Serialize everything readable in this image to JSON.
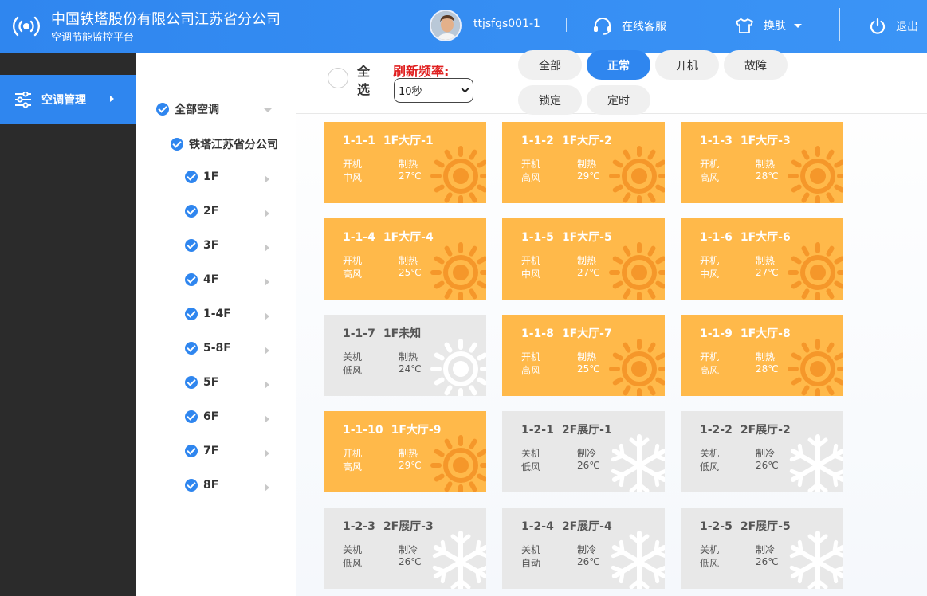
{
  "header": {
    "title_main": "中国铁塔股份有限公司江苏省分公司",
    "title_sub": "空调节能监控平台",
    "username": "ttjsfgs001-1",
    "service": "在线客服",
    "skin": "换肤",
    "logout": "退出"
  },
  "sidebar": {
    "items": [
      {
        "label": "空调管理"
      }
    ]
  },
  "tree": {
    "root": "全部空调",
    "company": "铁塔江苏省分公司",
    "floors": [
      "1F",
      "2F",
      "3F",
      "4F",
      "1-4F",
      "5-8F",
      "5F",
      "6F",
      "7F",
      "8F"
    ]
  },
  "toolbar": {
    "select_all": "全选",
    "refresh_label": "刷新频率:",
    "refresh_value": "10秒",
    "filters": [
      "全部",
      "正常",
      "开机",
      "故障",
      "锁定",
      "定时"
    ],
    "active_filter": "正常"
  },
  "colors": {
    "primary": "#2f86ef",
    "card_on": "#ffb94a",
    "card_off": "#e8e8e8",
    "refresh_label": "#e02020"
  },
  "cards": [
    {
      "id": "1-1-1",
      "name": "1F大厅-1",
      "power": "开机",
      "mode": "制热",
      "fan": "中风",
      "temp": "27℃",
      "state": "on",
      "icon": "sun-icon"
    },
    {
      "id": "1-1-2",
      "name": "1F大厅-2",
      "power": "开机",
      "mode": "制热",
      "fan": "高风",
      "temp": "29℃",
      "state": "on",
      "icon": "sun-icon"
    },
    {
      "id": "1-1-3",
      "name": "1F大厅-3",
      "power": "开机",
      "mode": "制热",
      "fan": "高风",
      "temp": "28℃",
      "state": "on",
      "icon": "sun-icon"
    },
    {
      "id": "1-1-4",
      "name": "1F大厅-4",
      "power": "开机",
      "mode": "制热",
      "fan": "高风",
      "temp": "25℃",
      "state": "on",
      "icon": "sun-icon"
    },
    {
      "id": "1-1-5",
      "name": "1F大厅-5",
      "power": "开机",
      "mode": "制热",
      "fan": "中风",
      "temp": "27℃",
      "state": "on",
      "icon": "sun-icon"
    },
    {
      "id": "1-1-6",
      "name": "1F大厅-6",
      "power": "开机",
      "mode": "制热",
      "fan": "中风",
      "temp": "27℃",
      "state": "on",
      "icon": "sun-icon"
    },
    {
      "id": "1-1-7",
      "name": "1F未知",
      "power": "关机",
      "mode": "制热",
      "fan": "低风",
      "temp": "24℃",
      "state": "off",
      "icon": "sun-icon"
    },
    {
      "id": "1-1-8",
      "name": "1F大厅-7",
      "power": "开机",
      "mode": "制热",
      "fan": "高风",
      "temp": "25℃",
      "state": "on",
      "icon": "sun-icon"
    },
    {
      "id": "1-1-9",
      "name": "1F大厅-8",
      "power": "开机",
      "mode": "制热",
      "fan": "高风",
      "temp": "28℃",
      "state": "on",
      "icon": "sun-icon"
    },
    {
      "id": "1-1-10",
      "name": "1F大厅-9",
      "power": "开机",
      "mode": "制热",
      "fan": "高风",
      "temp": "29℃",
      "state": "on",
      "icon": "sun-icon"
    },
    {
      "id": "1-2-1",
      "name": "2F展厅-1",
      "power": "关机",
      "mode": "制冷",
      "fan": "低风",
      "temp": "26℃",
      "state": "cool",
      "icon": "snowflake-icon"
    },
    {
      "id": "1-2-2",
      "name": "2F展厅-2",
      "power": "关机",
      "mode": "制冷",
      "fan": "低风",
      "temp": "26℃",
      "state": "cool",
      "icon": "snowflake-icon"
    },
    {
      "id": "1-2-3",
      "name": "2F展厅-3",
      "power": "关机",
      "mode": "制冷",
      "fan": "低风",
      "temp": "26℃",
      "state": "cool",
      "icon": "snowflake-icon"
    },
    {
      "id": "1-2-4",
      "name": "2F展厅-4",
      "power": "关机",
      "mode": "制冷",
      "fan": "自动",
      "temp": "26℃",
      "state": "cool",
      "icon": "snowflake-icon"
    },
    {
      "id": "1-2-5",
      "name": "2F展厅-5",
      "power": "关机",
      "mode": "制冷",
      "fan": "低风",
      "temp": "26℃",
      "state": "cool",
      "icon": "snowflake-icon"
    }
  ]
}
